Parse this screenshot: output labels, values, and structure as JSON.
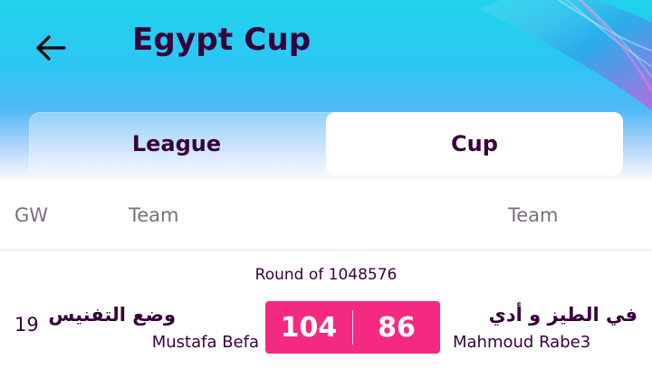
{
  "header": {
    "title": "Egypt Cup",
    "back_icon": "arrow-left-icon",
    "colors": {
      "gradient_top": "#1fd3ea",
      "gradient_mid": "#50b9f6",
      "title": "#37003c"
    }
  },
  "tabs": [
    {
      "label": "League",
      "selected": false
    },
    {
      "label": "Cup",
      "selected": true
    }
  ],
  "table": {
    "headers": {
      "gw": "GW",
      "team_left": "Team",
      "team_right": "Team"
    }
  },
  "match": {
    "round": "Round of 1048576",
    "gw": "19",
    "home": {
      "team": "وضع التفنيس",
      "manager": "Mustafa Befa",
      "score": "104"
    },
    "away": {
      "team": "في الطيز و أدي",
      "manager": "Mahmoud Rabe3",
      "score": "86"
    },
    "score_color": "#f42a82"
  }
}
